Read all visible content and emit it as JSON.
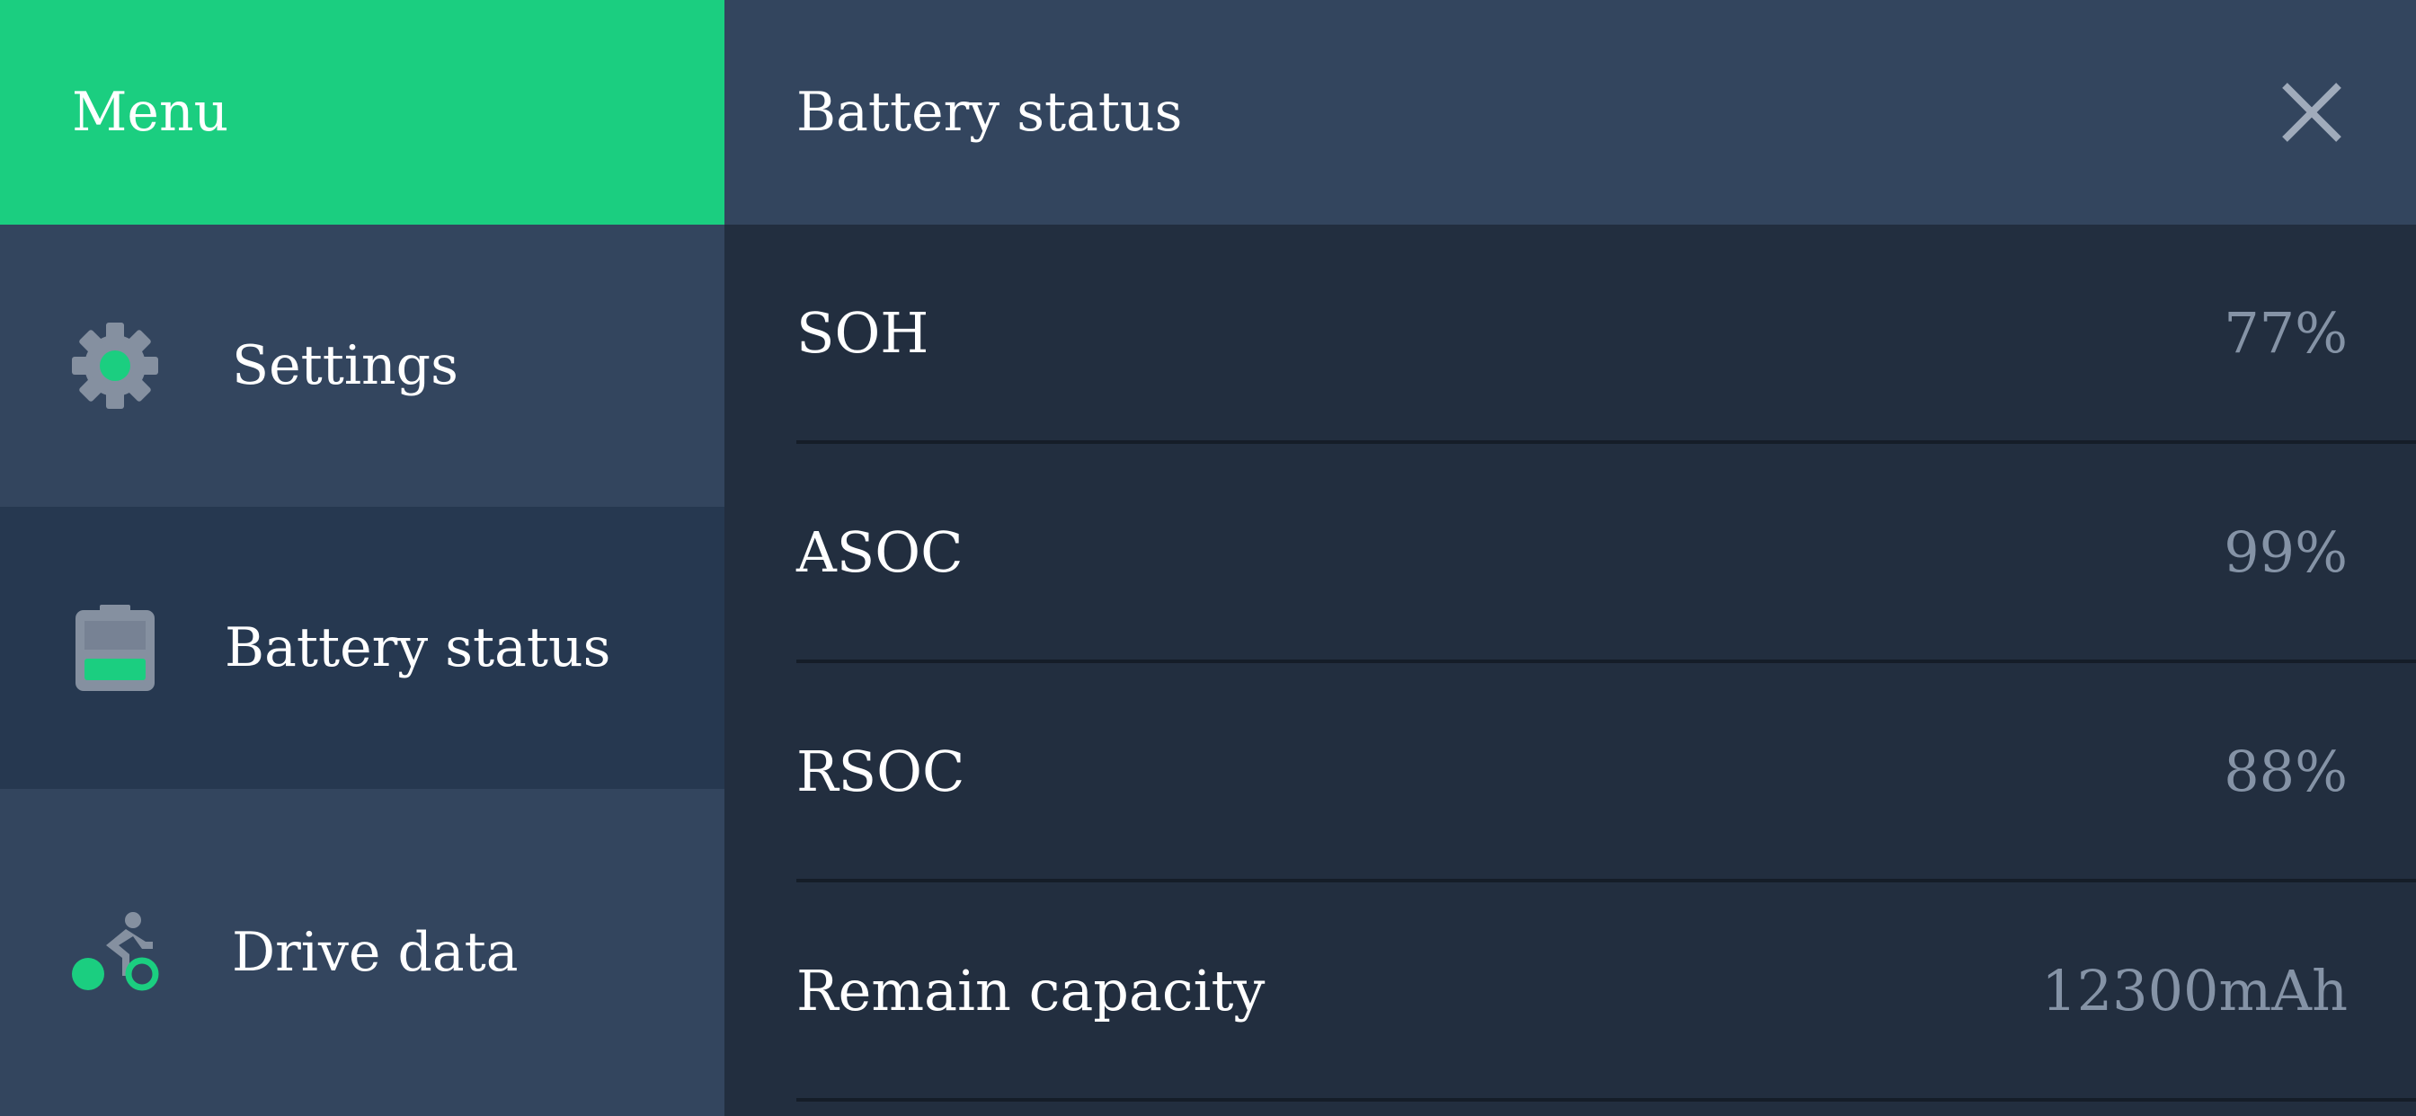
{
  "sidebar": {
    "title": "Menu",
    "items": [
      {
        "label": "Settings",
        "icon": "gear-icon"
      },
      {
        "label": "Battery status",
        "icon": "battery-icon"
      },
      {
        "label": "Drive data",
        "icon": "bicycle-rider-icon"
      }
    ]
  },
  "main": {
    "title": "Battery status",
    "close_icon": "close-icon",
    "rows": [
      {
        "label": "SOH",
        "value": "77%"
      },
      {
        "label": "ASOC",
        "value": "99%"
      },
      {
        "label": "RSOC",
        "value": "88%"
      },
      {
        "label": "Remain capacity",
        "value": "12300mAh"
      }
    ]
  },
  "colors": {
    "accent": "#1bce80",
    "sidebar_bg": "#33455e",
    "active_bg": "#263850",
    "main_bg": "#222e3f",
    "value_text": "#8593a6"
  }
}
